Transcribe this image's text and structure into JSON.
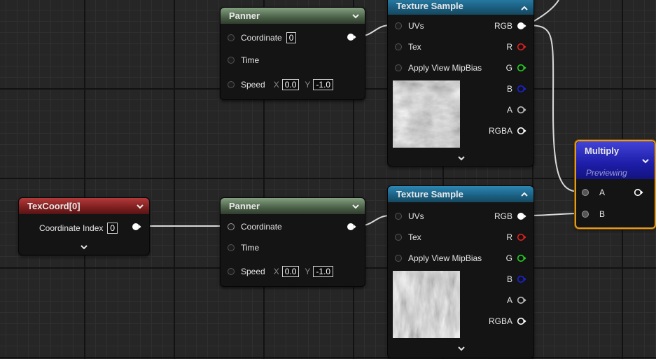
{
  "colors": {
    "wire": "#d9d9d9",
    "pin_r": "#e02020",
    "pin_g": "#22d022",
    "pin_b": "#1a22d8",
    "selection": "#e49a1c"
  },
  "panner_top": {
    "title": "Panner",
    "coordinate_label": "Coordinate",
    "coordinate_value": "0",
    "time_label": "Time",
    "speed_label": "Speed",
    "speed_x_axis": "X",
    "speed_x": "0.0",
    "speed_y_axis": "Y",
    "speed_y": "-1.0"
  },
  "panner_bottom": {
    "title": "Panner",
    "coordinate_label": "Coordinate",
    "time_label": "Time",
    "speed_label": "Speed",
    "speed_x_axis": "X",
    "speed_x": "0.0",
    "speed_y_axis": "Y",
    "speed_y": "-1.0"
  },
  "texture_top": {
    "title": "Texture Sample",
    "uvs": "UVs",
    "tex": "Tex",
    "mipbias": "Apply View MipBias",
    "rgb": "RGB",
    "r": "R",
    "g": "G",
    "b": "B",
    "a": "A",
    "rgba": "RGBA"
  },
  "texture_bottom": {
    "title": "Texture Sample",
    "uvs": "UVs",
    "tex": "Tex",
    "mipbias": "Apply View MipBias",
    "rgb": "RGB",
    "r": "R",
    "g": "G",
    "b": "B",
    "a": "A",
    "rgba": "RGBA"
  },
  "texcoord": {
    "title": "TexCoord[0]",
    "index_label": "Coordinate Index",
    "index_value": "0"
  },
  "multiply": {
    "title": "Multiply",
    "status": "Previewing",
    "input_a": "A",
    "input_b": "B"
  }
}
